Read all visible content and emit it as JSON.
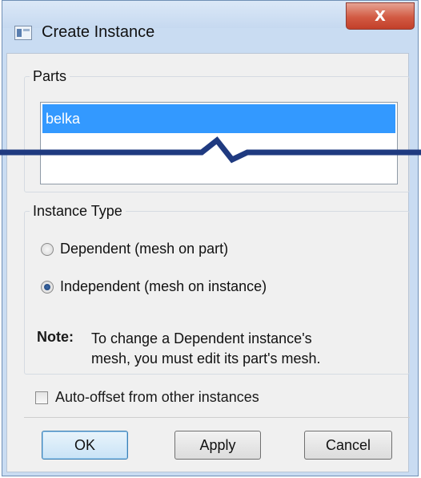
{
  "window": {
    "title": "Create Instance",
    "close_glyph": "X"
  },
  "parts": {
    "legend": "Parts",
    "items": [
      "belka"
    ],
    "selected_index": 0
  },
  "instance_type": {
    "legend": "Instance Type",
    "options": [
      {
        "label": "Dependent (mesh on part)",
        "checked": false
      },
      {
        "label": "Independent (mesh on instance)",
        "checked": true
      }
    ],
    "note_label": "Note:",
    "note_line1": "To change a Dependent instance's",
    "note_line2": "mesh, you must edit its part's mesh."
  },
  "auto_offset": {
    "label": "Auto-offset from other instances",
    "checked": false
  },
  "buttons": {
    "ok": "OK",
    "apply": "Apply",
    "cancel": "Cancel"
  },
  "colors": {
    "selection": "#3399ff",
    "break_line": "#1f3a80",
    "close_button": "#d25a43"
  }
}
